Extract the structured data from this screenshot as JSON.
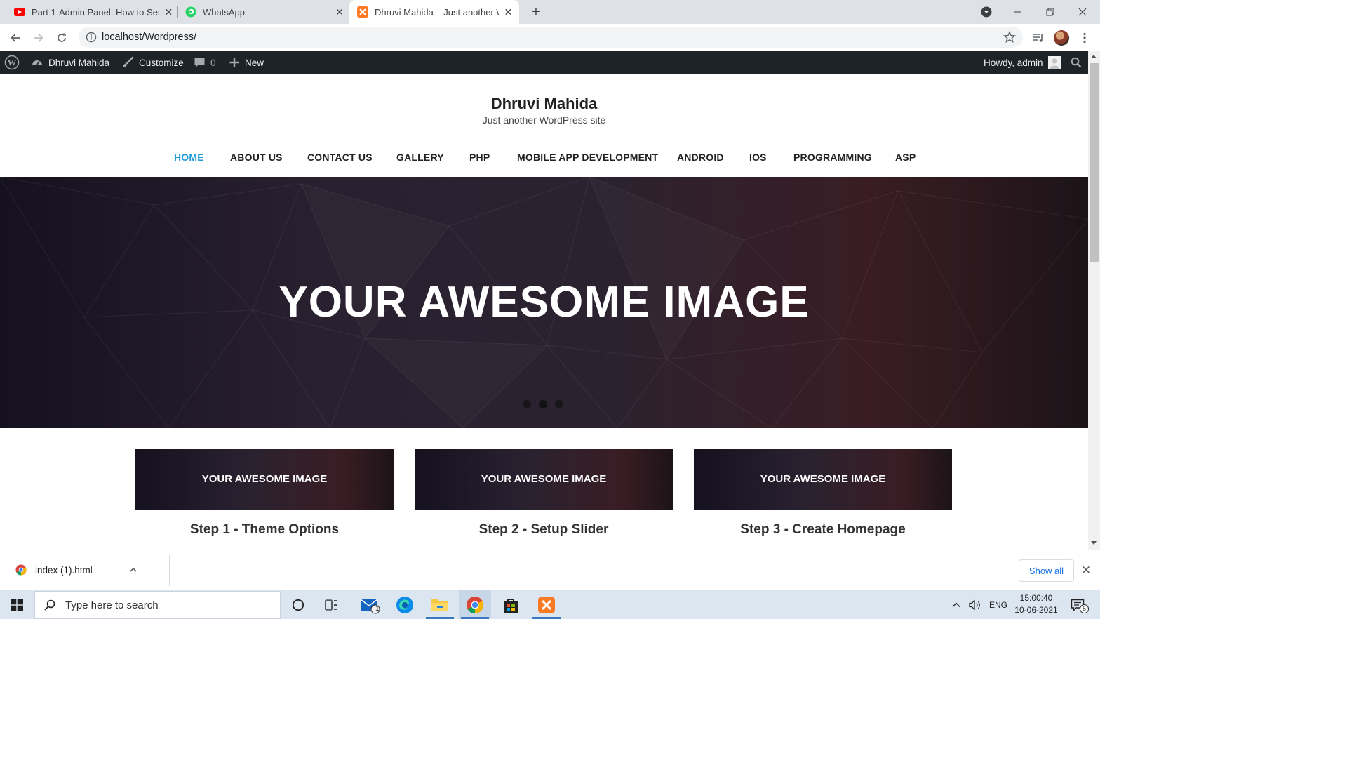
{
  "browser": {
    "tabs": [
      {
        "title": "Part 1-Admin Panel: How to Setu",
        "favicon": "youtube-icon"
      },
      {
        "title": "WhatsApp",
        "favicon": "whatsapp-icon"
      },
      {
        "title": "Dhruvi Mahida – Just another W",
        "favicon": "xampp-icon",
        "active": true
      }
    ],
    "url": "localhost/Wordpress/"
  },
  "adminbar": {
    "site_name": "Dhruvi Mahida",
    "customize": "Customize",
    "comments_count": "0",
    "new_label": "New",
    "howdy": "Howdy, admin"
  },
  "site": {
    "title": "Dhruvi Mahida",
    "tagline": "Just another WordPress site",
    "nav": [
      "HOME",
      "ABOUT US",
      "CONTACT US",
      "GALLERY",
      "PHP",
      "MOBILE APP DEVELOPMENT",
      "ANDROID",
      "IOS",
      "PROGRAMMING",
      "ASP"
    ],
    "current_nav": "HOME",
    "hero_text": "YOUR AWESOME IMAGE",
    "slider_dots": 3,
    "active_dot": 2,
    "cards": [
      {
        "image_text": "YOUR AWESOME IMAGE",
        "title": "Step 1 - Theme Options"
      },
      {
        "image_text": "YOUR AWESOME IMAGE",
        "title": "Step 2 - Setup Slider"
      },
      {
        "image_text": "YOUR AWESOME IMAGE",
        "title": "Step 3 - Create Homepage"
      }
    ],
    "accent_color": "#1e9bd7"
  },
  "download_bar": {
    "file_name": "index (1).html",
    "show_all": "Show all"
  },
  "taskbar": {
    "search_placeholder": "Type here to search",
    "language": "ENG",
    "time": "15:00:40",
    "date": "10-06-2021",
    "mail_badge": "1",
    "notification_badge": "5"
  }
}
